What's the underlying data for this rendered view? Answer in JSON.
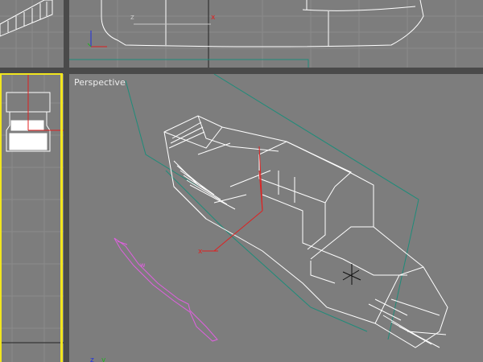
{
  "viewports": {
    "top_left": {
      "label": ""
    },
    "top": {
      "label": ""
    },
    "left": {
      "label": ""
    },
    "perspective": {
      "label": "Perspective"
    }
  },
  "axis_labels": {
    "x": "x",
    "y": "y",
    "z": "z"
  },
  "colors": {
    "background": "#7d7d7d",
    "grid": "#8a8a8a",
    "wireframe": "#ffffff",
    "camera": "#1f8c7a",
    "axis_x": "#e02020",
    "axis_y": "#20b020",
    "axis_z": "#2030e0",
    "selection": "#e060e0",
    "active_viewport": "#f2e61e"
  }
}
